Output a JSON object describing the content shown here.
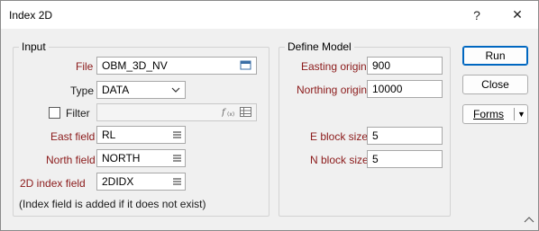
{
  "window": {
    "title": "Index 2D",
    "help_label": "?",
    "close_label": "✕"
  },
  "input": {
    "legend": "Input",
    "file": {
      "label": "File",
      "value": "OBM_3D_NV"
    },
    "type": {
      "label": "Type",
      "value": "DATA"
    },
    "filter": {
      "label": "Filter",
      "value": "",
      "checked": false
    },
    "east": {
      "label": "East field",
      "value": "RL"
    },
    "north": {
      "label": "North field",
      "value": "NORTH"
    },
    "index": {
      "label": "2D index field",
      "value": "2DIDX"
    },
    "note": "(Index field is added if it does not exist)"
  },
  "model": {
    "legend": "Define Model",
    "easting": {
      "label": "Easting origin",
      "value": "900"
    },
    "northing": {
      "label": "Northing origin",
      "value": "10000"
    },
    "eblock": {
      "label": "E block size",
      "value": "5"
    },
    "nblock": {
      "label": "N block size",
      "value": "5"
    }
  },
  "buttons": {
    "run": "Run",
    "close": "Close",
    "forms": "Forms"
  },
  "colors": {
    "required_label": "#8b1a1a",
    "accent": "#0067c0",
    "list_icon": "#4a4a4a"
  }
}
